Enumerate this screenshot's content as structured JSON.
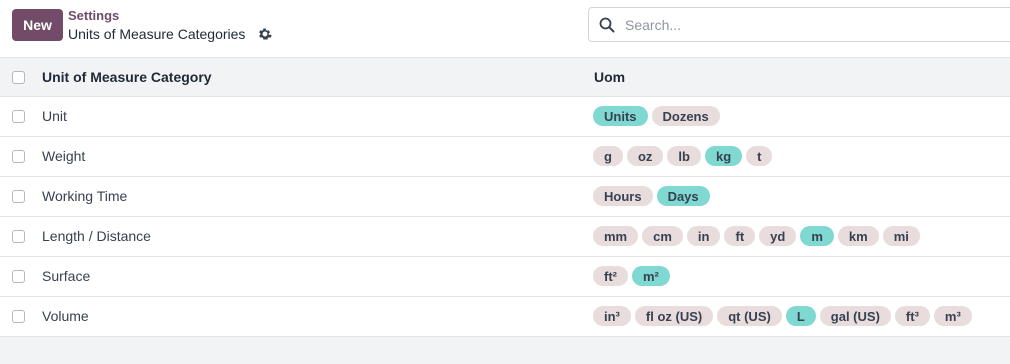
{
  "header": {
    "new_label": "New",
    "breadcrumb": "Settings",
    "title": "Units of Measure Categories"
  },
  "search": {
    "placeholder": "Search..."
  },
  "table": {
    "columns": [
      "Unit of Measure Category",
      "Uom"
    ],
    "rows": [
      {
        "name": "Unit",
        "uoms": [
          {
            "label": "Units",
            "active": true
          },
          {
            "label": "Dozens",
            "active": false
          }
        ]
      },
      {
        "name": "Weight",
        "uoms": [
          {
            "label": "g",
            "active": false
          },
          {
            "label": "oz",
            "active": false
          },
          {
            "label": "lb",
            "active": false
          },
          {
            "label": "kg",
            "active": true
          },
          {
            "label": "t",
            "active": false
          }
        ]
      },
      {
        "name": "Working Time",
        "uoms": [
          {
            "label": "Hours",
            "active": false
          },
          {
            "label": "Days",
            "active": true
          }
        ]
      },
      {
        "name": "Length / Distance",
        "uoms": [
          {
            "label": "mm",
            "active": false
          },
          {
            "label": "cm",
            "active": false
          },
          {
            "label": "in",
            "active": false
          },
          {
            "label": "ft",
            "active": false
          },
          {
            "label": "yd",
            "active": false
          },
          {
            "label": "m",
            "active": true
          },
          {
            "label": "km",
            "active": false
          },
          {
            "label": "mi",
            "active": false
          }
        ]
      },
      {
        "name": "Surface",
        "uoms": [
          {
            "label": "ft²",
            "active": false
          },
          {
            "label": "m²",
            "active": true
          }
        ]
      },
      {
        "name": "Volume",
        "uoms": [
          {
            "label": "in³",
            "active": false
          },
          {
            "label": "fl oz (US)",
            "active": false
          },
          {
            "label": "qt (US)",
            "active": false
          },
          {
            "label": "L",
            "active": true
          },
          {
            "label": "gal (US)",
            "active": false
          },
          {
            "label": "ft³",
            "active": false
          },
          {
            "label": "m³",
            "active": false
          }
        ]
      }
    ]
  },
  "colors": {
    "brand": "#714b67",
    "tag_default": "#e8dcdc",
    "tag_reference": "#7fd8d1"
  },
  "icons": {
    "settings": "gear-icon",
    "search": "search-icon"
  }
}
